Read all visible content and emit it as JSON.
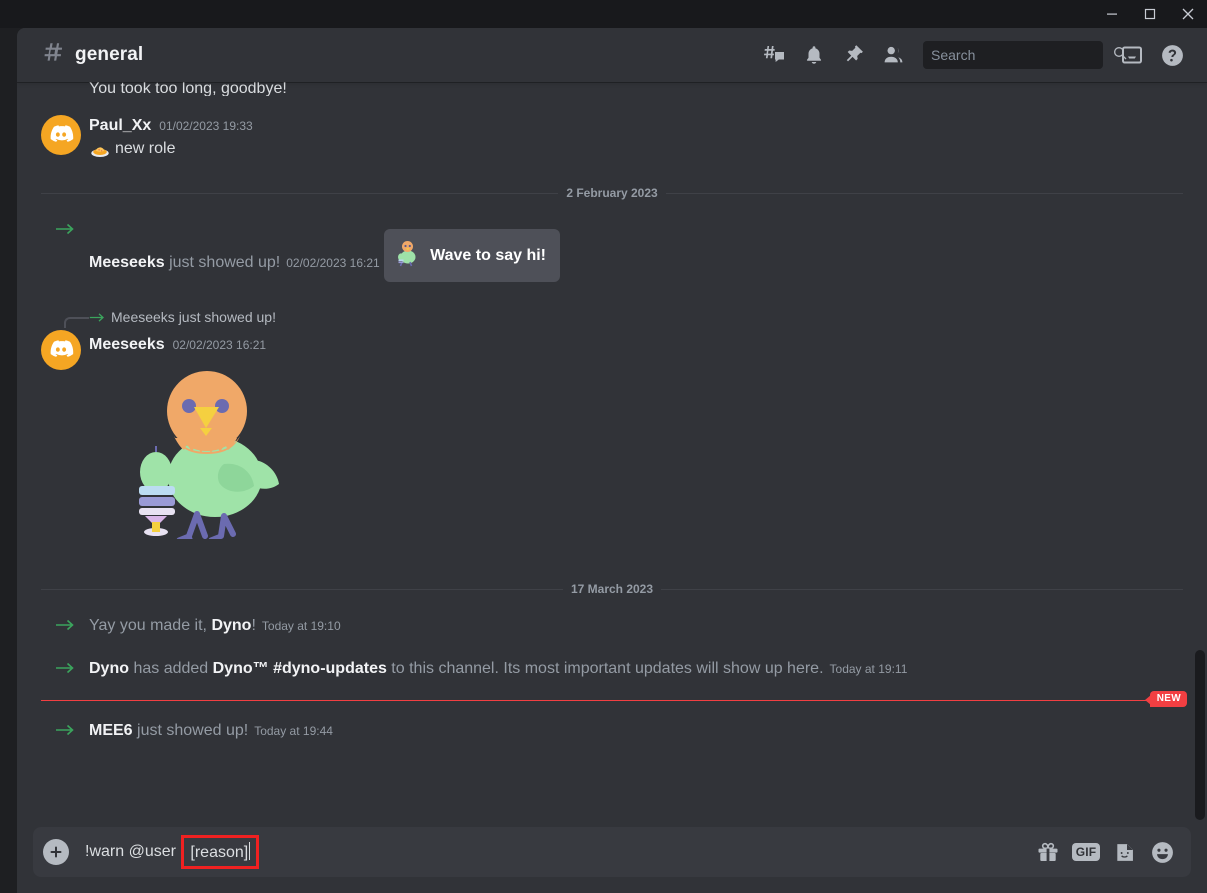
{
  "window": {
    "minimize_label": "Minimize",
    "maximize_label": "Maximize",
    "close_label": "Close"
  },
  "header": {
    "channel_name": "general",
    "hash_icon": "hash-icon",
    "icons": [
      {
        "name": "threads-icon",
        "label": "Threads"
      },
      {
        "name": "bell-icon",
        "label": "Notification Settings"
      },
      {
        "name": "pin-icon",
        "label": "Pinned Messages"
      },
      {
        "name": "members-icon",
        "label": "Member List"
      }
    ],
    "search": {
      "placeholder": "Search",
      "value": "",
      "icon": "search-icon"
    },
    "inbox_label": "Inbox",
    "help_label": "Help"
  },
  "messages": {
    "cutoff_text": "You took too long, goodbye!",
    "paul": {
      "author": "Paul_Xx",
      "timestamp": "01/02/2023 19:33",
      "emoji_name": "curry-rice-emoji",
      "text": "new role"
    },
    "divider_feb": "2 February 2023",
    "join_meeseeks": {
      "author": "Meeseeks",
      "text": " just showed up!",
      "timestamp": "02/02/2023 16:21",
      "wave_button": "Wave to say hi!"
    },
    "reply_ref": {
      "arrow": "reply-arrow-icon",
      "text": "Meeseeks just showed up!"
    },
    "sticker_msg": {
      "author": "Meeseeks",
      "timestamp": "02/02/2023 16:21",
      "sticker_name": "bird-with-cake-sticker"
    },
    "divider_mar": "17 March 2023",
    "sys_dyno_welcome": {
      "prefix": "Yay you made it, ",
      "bold": "Dyno",
      "suffix": "!",
      "timestamp": "Today at 19:10"
    },
    "sys_dyno_added": {
      "bold1": "Dyno",
      "mid1": " has added ",
      "bold2": "Dyno™ #dyno-updates",
      "mid2": " to this channel. Its most important updates will show up here.",
      "timestamp": "Today at 19:11"
    },
    "new_badge": "NEW",
    "sys_mee6": {
      "bold": "MEE6",
      "text": " just showed up!",
      "timestamp": "Today at 19:44"
    }
  },
  "composer": {
    "plus_label": "Upload",
    "text_before": "!warn @user ",
    "highlighted": "[reason]",
    "icons": [
      {
        "name": "gift-icon",
        "label": "Gift"
      },
      {
        "name": "gif-icon",
        "label": "GIF"
      },
      {
        "name": "sticker-icon",
        "label": "Sticker"
      },
      {
        "name": "emoji-icon",
        "label": "Emoji"
      }
    ]
  },
  "colors": {
    "background": "#313338",
    "titlebar": "#18191c",
    "accent_green": "#3ba55d",
    "accent_red": "#f23f42",
    "highlight_red": "#f02121",
    "avatar_orange": "#f5a623"
  }
}
